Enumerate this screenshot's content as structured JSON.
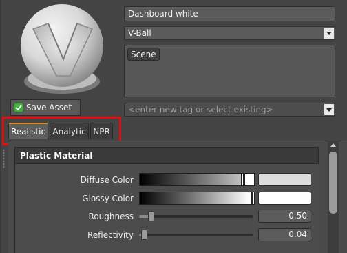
{
  "asset": {
    "name_value": "Dashboard white",
    "environment_selected": "V-Ball",
    "tags": [
      "Scene"
    ],
    "tag_placeholder": "<enter new tag or select existing>",
    "save_label": "Save Asset"
  },
  "tabs": [
    {
      "label": "Realistic",
      "active": true
    },
    {
      "label": "Analytic",
      "active": false
    },
    {
      "label": "NPR",
      "active": false
    }
  ],
  "material": {
    "section_title": "Plastic Material",
    "diffuse": {
      "label": "Diffuse Color",
      "swatch_color": "#dcdcdc"
    },
    "glossy": {
      "label": "Glossy Color",
      "swatch_color": "#ffffff"
    },
    "roughness": {
      "label": "Roughness",
      "value": "0.50",
      "level": 0.1
    },
    "reflectivity": {
      "label": "Reflectivity",
      "value": "0.04",
      "level": 0.04
    }
  },
  "colors": {
    "highlight": "#e01010",
    "tab_accent": "#e08a1e",
    "save_icon": "#3fae3f"
  }
}
